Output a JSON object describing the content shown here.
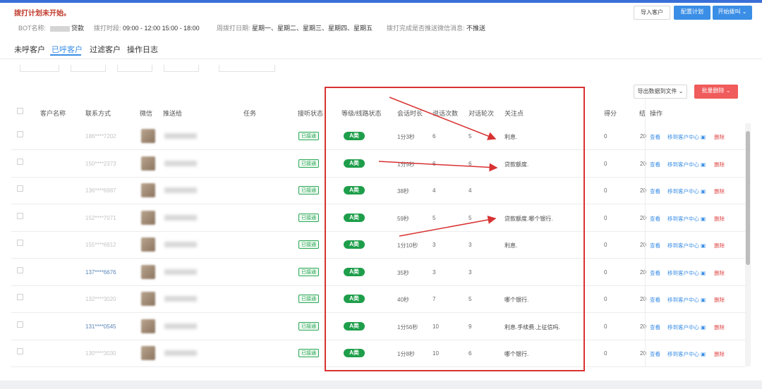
{
  "status": "拨打计划未开始。",
  "buttons": {
    "import": "导入客户",
    "config": "配置计划",
    "start": "开始拨叫",
    "export": "导出数据到文件",
    "batch_delete": "批量删除"
  },
  "info": {
    "bot_label": "BOT名称:",
    "bot_value": "贷款",
    "time_label": "拨打时段:",
    "time_value": "09:00 - 12:00 15:00 - 18:00",
    "day_label": "周拨打日期:",
    "day_value": "星期一、星期二、星期三、星期四、星期五",
    "wechat_label": "拨打完成是否推送微信消息:",
    "wechat_value": "不推送"
  },
  "tabs": [
    "未呼客户",
    "已呼客户",
    "过滤客户",
    "操作日志"
  ],
  "active_tab": 1,
  "columns": [
    "客户名称",
    "联系方式",
    "微信",
    "推送给",
    "任务",
    "接听状态",
    "等级/线路状态",
    "会话时长",
    "说话次数",
    "对话轮次",
    "关注点",
    "得分",
    "结",
    "操作"
  ],
  "rows": [
    {
      "phone": "186****7202",
      "status": "已接通",
      "level": "A类",
      "duration": "1分3秒",
      "speak": "6",
      "rounds": "5",
      "focus": "利息.",
      "score": "0",
      "date": "20"
    },
    {
      "phone": "150****2373",
      "status": "已接通",
      "level": "A类",
      "duration": "1分9秒",
      "speak": "6",
      "rounds": "6",
      "focus": "贷款额度.",
      "score": "0",
      "date": "20"
    },
    {
      "phone": "136****6987",
      "status": "已接通",
      "level": "A类",
      "duration": "38秒",
      "speak": "4",
      "rounds": "4",
      "focus": "",
      "score": "0",
      "date": "20"
    },
    {
      "phone": "152****7071",
      "status": "已接通",
      "level": "A类",
      "duration": "59秒",
      "speak": "5",
      "rounds": "5",
      "focus": "贷款额度.哪个银行.",
      "score": "0",
      "date": "20"
    },
    {
      "phone": "155****6912",
      "status": "已接通",
      "level": "A类",
      "duration": "1分10秒",
      "speak": "3",
      "rounds": "3",
      "focus": "利息.",
      "score": "0",
      "date": "20"
    },
    {
      "phone": "137****6676",
      "status": "已接通",
      "level": "A类",
      "duration": "35秒",
      "speak": "3",
      "rounds": "3",
      "focus": "",
      "score": "0",
      "date": "20"
    },
    {
      "phone": "132****3020",
      "status": "已接通",
      "level": "A类",
      "duration": "40秒",
      "speak": "7",
      "rounds": "5",
      "focus": "哪个银行.",
      "score": "0",
      "date": "20"
    },
    {
      "phone": "131****0545",
      "status": "已接通",
      "level": "A类",
      "duration": "1分56秒",
      "speak": "10",
      "rounds": "9",
      "focus": "利息.手续费.上征信吗.",
      "score": "0",
      "date": "20"
    },
    {
      "phone": "130****3030",
      "status": "已接通",
      "level": "A类",
      "duration": "1分8秒",
      "speak": "10",
      "rounds": "6",
      "focus": "哪个银行.",
      "score": "0",
      "date": "20"
    }
  ],
  "ops": {
    "view": "查看",
    "move": "移到客户中心",
    "delete": "删除"
  },
  "colors": {
    "accent": "#3a8ee6",
    "danger": "#f05b5b",
    "level": "#1e9e4a",
    "annotation": "#d83232"
  }
}
